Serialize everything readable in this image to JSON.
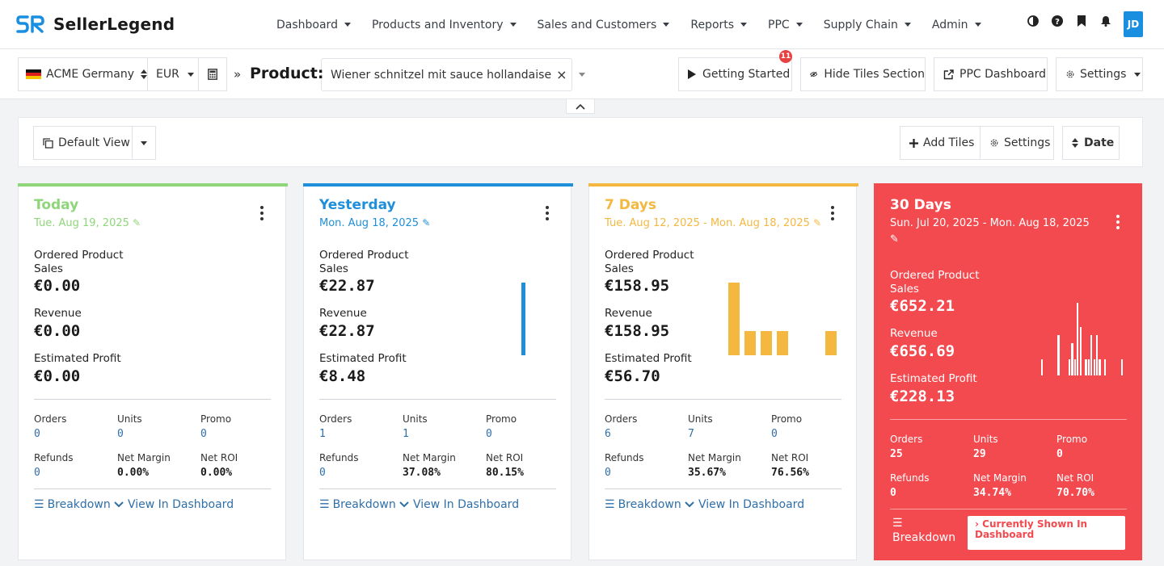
{
  "app": {
    "name": "SellerLegend",
    "avatar_initials": "JD"
  },
  "nav": {
    "menu": [
      "Dashboard",
      "Products and Inventory",
      "Sales and Customers",
      "Reports",
      "PPC",
      "Supply Chain",
      "Admin"
    ],
    "icons": [
      "contrast-icon",
      "help-icon",
      "bookmark-icon",
      "bell-icon"
    ]
  },
  "subheader": {
    "account": "ACME Germany",
    "currency": "EUR",
    "product_label": "Product:",
    "product_value": "Wiener schnitzel mit sauce hollandaise",
    "getting_started": "Getting Started",
    "getting_started_badge": "11",
    "hide_tiles": "Hide Tiles Section",
    "ppc_dashboard": "PPC Dashboard",
    "settings": "Settings"
  },
  "toolbar": {
    "view": "Default View",
    "add_tiles": "Add Tiles",
    "settings": "Settings",
    "date": "Date"
  },
  "labels": {
    "ordered_product_sales_1": "Ordered Product",
    "ordered_product_sales_2": "Sales",
    "revenue": "Revenue",
    "estimated_profit": "Estimated Profit",
    "orders": "Orders",
    "units": "Units",
    "promo": "Promo",
    "refunds": "Refunds",
    "net_margin": "Net Margin",
    "net_roi": "Net ROI",
    "breakdown": "Breakdown",
    "view_in_dashboard": "View In Dashboard",
    "currently_shown_1": "Currently Shown In",
    "currently_shown_2": "Dashboard"
  },
  "cards": [
    {
      "title": "Today",
      "date": "Tue. Aug 19, 2025",
      "color": "#8fd67a",
      "sales": "€0.00",
      "revenue": "€0.00",
      "profit": "€0.00",
      "orders": "0",
      "units": "0",
      "promo": "0",
      "refunds": "0",
      "net_margin": "0.00%",
      "net_roi": "0.00%",
      "chart": []
    },
    {
      "title": "Yesterday",
      "date": "Mon. Aug 18, 2025",
      "color": "#1f8fd9",
      "sales": "€22.87",
      "revenue": "€22.87",
      "profit": "€8.48",
      "orders": "1",
      "units": "1",
      "promo": "0",
      "refunds": "0",
      "net_margin": "37.08%",
      "net_roi": "80.15%",
      "chart": [
        22.87
      ]
    },
    {
      "title": "7 Days",
      "date": "Tue. Aug 12, 2025 - Mon. Aug 18, 2025",
      "color": "#f4b840",
      "sales": "€158.95",
      "revenue": "€158.95",
      "profit": "€56.70",
      "orders": "6",
      "units": "7",
      "promo": "0",
      "refunds": "0",
      "net_margin": "35.67%",
      "net_roi": "76.56%",
      "chart": [
        45,
        15,
        15,
        15,
        0,
        0,
        15
      ]
    },
    {
      "title": "30 Days",
      "date_1": "Sun. Jul 20, 2025 - Mon. Aug 18, 2025",
      "color": "#f24a4f",
      "sales": "€652.21",
      "revenue": "€656.69",
      "profit": "€228.13",
      "orders": "25",
      "units": "29",
      "promo": "0",
      "refunds": "0",
      "net_margin": "34.74%",
      "net_roi": "70.70%",
      "chart": [
        1,
        0,
        0,
        0,
        0,
        0,
        2.5,
        0,
        0,
        0,
        1,
        2,
        1,
        4.5,
        3,
        0,
        1,
        1,
        2.5,
        1,
        2.5,
        1,
        0,
        1,
        0,
        0,
        0,
        0,
        0,
        1
      ]
    }
  ]
}
